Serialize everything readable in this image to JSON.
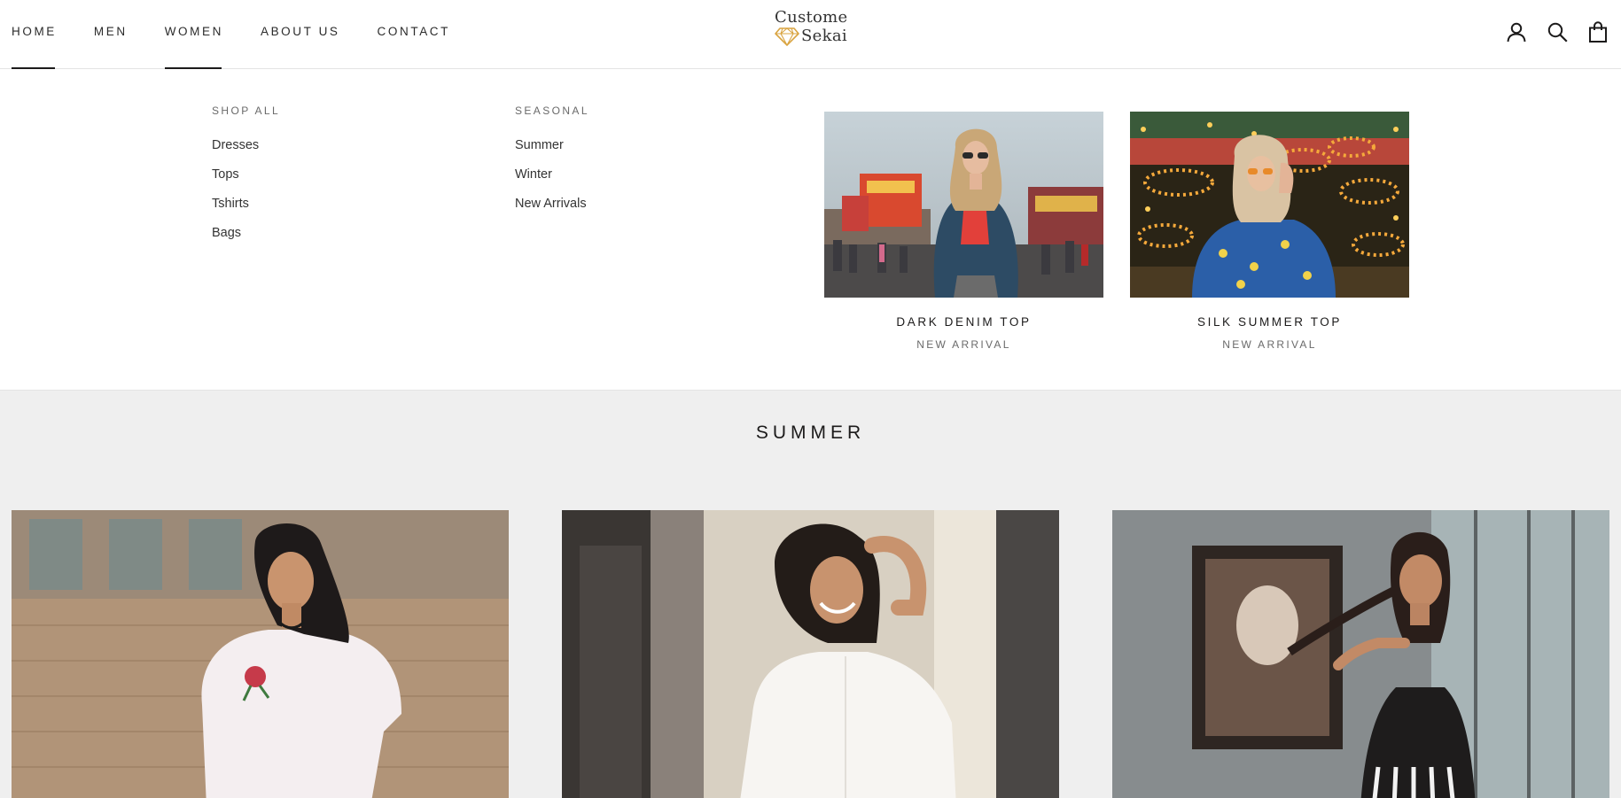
{
  "header": {
    "nav": [
      {
        "label": "HOME",
        "active": true
      },
      {
        "label": "MEN",
        "active": false
      },
      {
        "label": "WOMEN",
        "active": true
      },
      {
        "label": "ABOUT US",
        "active": false
      },
      {
        "label": "CONTACT",
        "active": false
      }
    ],
    "logo": {
      "line1": "Custome",
      "line2": "Sekai",
      "icon": "diamond-icon",
      "icon_color": "#d9a441"
    },
    "icons": [
      "account-icon",
      "search-icon",
      "cart-icon"
    ]
  },
  "mega_menu": {
    "columns": [
      {
        "title": "SHOP ALL",
        "links": [
          "Dresses",
          "Tops",
          "Tshirts",
          "Bags"
        ]
      },
      {
        "title": "SEASONAL",
        "links": [
          "Summer",
          "Winter",
          "New Arrivals"
        ]
      }
    ],
    "promos": [
      {
        "title": "DARK DENIM TOP",
        "subtitle": "NEW ARRIVAL"
      },
      {
        "title": "SILK SUMMER TOP",
        "subtitle": "NEW ARRIVAL"
      }
    ]
  },
  "section": {
    "title": "SUMMER",
    "background": "#efefef",
    "products": [
      {
        "image": "woman-white-rose-tshirt"
      },
      {
        "image": "woman-white-shirt"
      },
      {
        "image": "woman-black-camisole"
      }
    ]
  }
}
